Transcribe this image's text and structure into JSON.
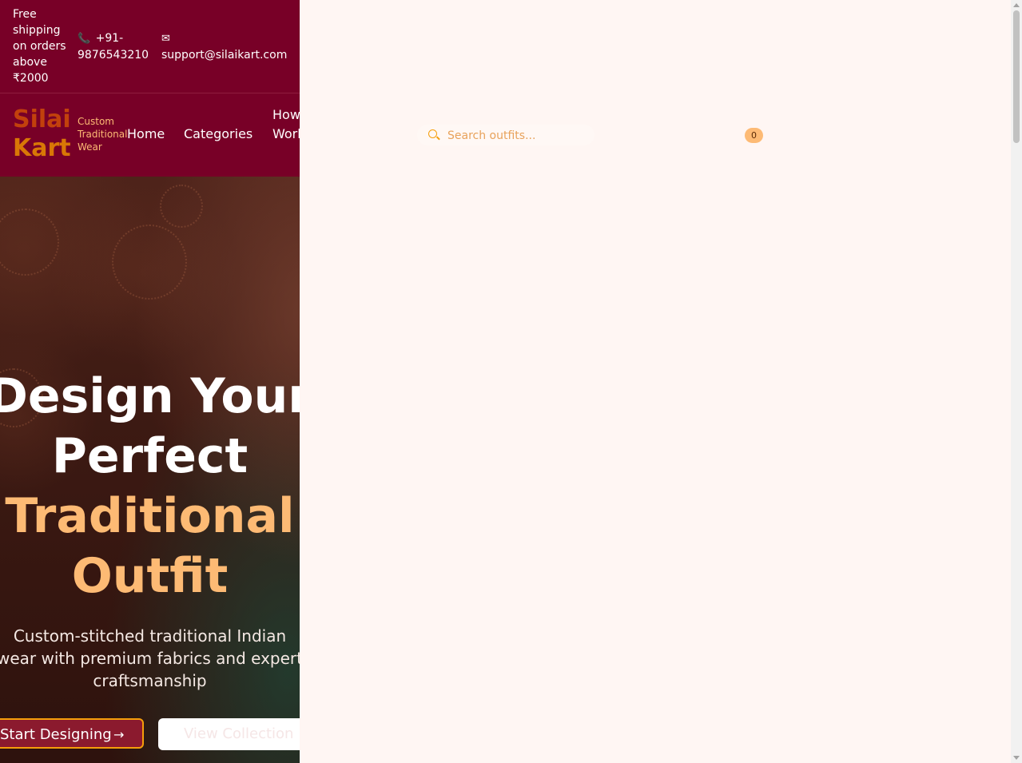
{
  "topbar": {
    "shipping": "Free shipping on orders above ₹2000",
    "phone": "+91-9876543210",
    "email": "support@silaikart.com"
  },
  "brand": {
    "name_line1": "Silai",
    "name_line2": "Kart",
    "tagline": "Custom Traditional Wear"
  },
  "nav": {
    "home": "Home",
    "categories": "Categories",
    "how_it_works": "How It Works"
  },
  "search": {
    "placeholder": "Search outfits..."
  },
  "cart": {
    "count": "0"
  },
  "hero": {
    "title_line1": "Design Your",
    "title_line2": "Perfect",
    "title_line3": "Traditional",
    "title_line4": "Outfit",
    "subtitle": "Custom-stitched traditional Indian wear with premium fabrics and expert craftsmanship",
    "primary_button": "Start Designing",
    "secondary_button": "View Collection"
  },
  "colors": {
    "brand_maroon": "#780027",
    "accent_orange": "#fdba74",
    "page_background": "#fff6f3"
  }
}
